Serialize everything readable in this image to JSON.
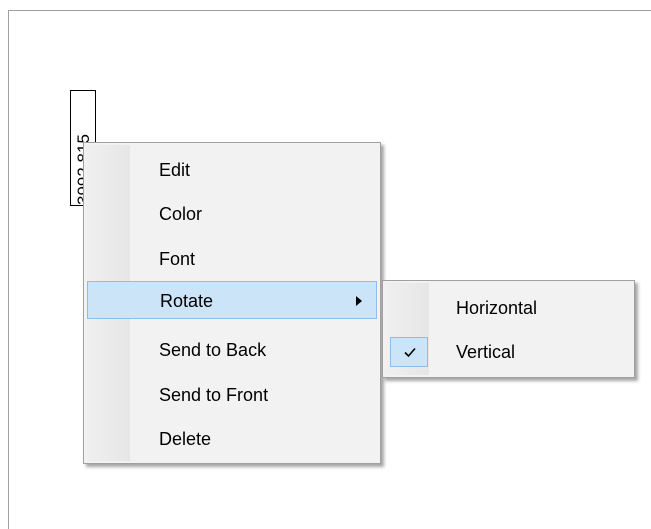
{
  "label": {
    "text": "3992.815"
  },
  "context_menu": {
    "items": [
      {
        "label": "Edit"
      },
      {
        "label": "Color"
      },
      {
        "label": "Font"
      },
      {
        "label": "Rotate",
        "has_submenu": true,
        "highlighted": true
      },
      {
        "label": "Send to Back"
      },
      {
        "label": "Send to Front"
      },
      {
        "label": "Delete"
      }
    ]
  },
  "rotate_submenu": {
    "items": [
      {
        "label": "Horizontal",
        "checked": false
      },
      {
        "label": "Vertical",
        "checked": true
      }
    ]
  },
  "colors": {
    "highlight": "#cce4f7",
    "highlight_border": "#8fbcea",
    "menu_bg": "#f2f2f2"
  },
  "icons": {
    "submenu_arrow": "chevron-right-icon",
    "checked": "checkmark-icon"
  }
}
